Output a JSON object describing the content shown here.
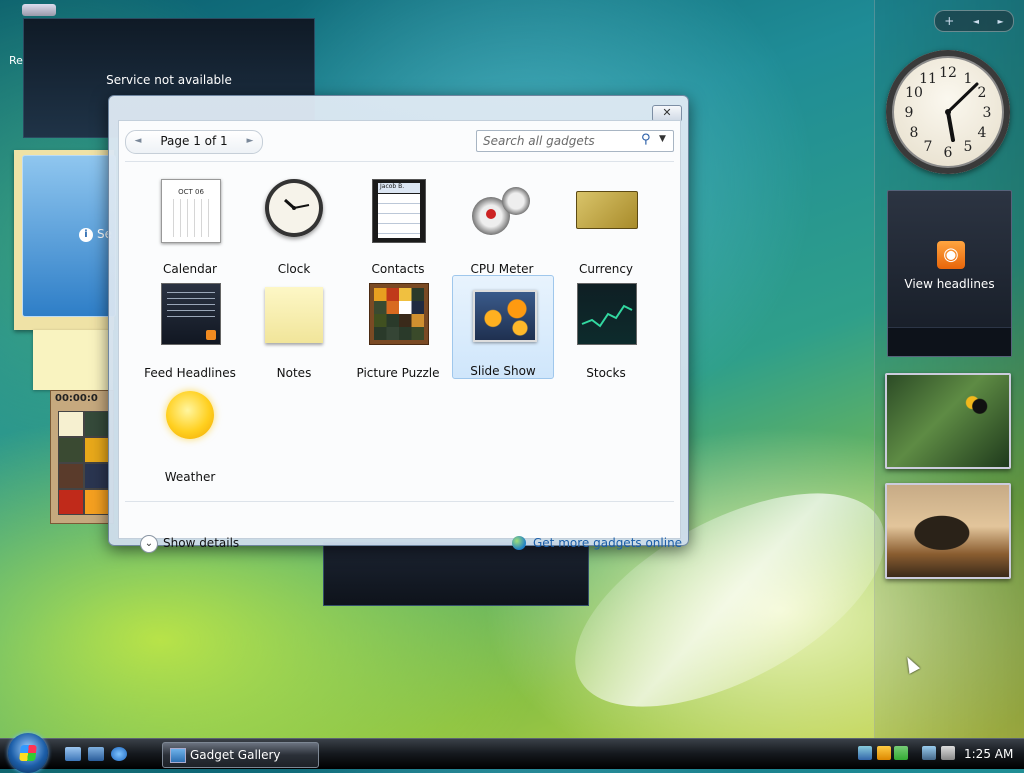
{
  "desktop": {
    "left_fragment_label": "Re",
    "bg_gadget_message": "Service not available",
    "bg_blue_fragment": "Se",
    "bg_puzzle_time": "00:00:0"
  },
  "sidebar": {
    "controls": {
      "add": "+",
      "prev": "◄",
      "next": "►"
    },
    "feed_label": "View headlines",
    "icons": [
      "clock-icon",
      "rss-icon"
    ]
  },
  "gallery": {
    "close_label": "✕",
    "pager": {
      "prev": "◄",
      "text": "Page 1 of 1",
      "next": "►"
    },
    "search": {
      "placeholder": "Search all gadgets"
    },
    "items": [
      {
        "label": "Calendar"
      },
      {
        "label": "Clock"
      },
      {
        "label": "Contacts"
      },
      {
        "label": "CPU Meter"
      },
      {
        "label": "Currency"
      },
      {
        "label": "Feed Headlines"
      },
      {
        "label": "Notes"
      },
      {
        "label": "Picture Puzzle"
      },
      {
        "label": "Slide Show",
        "selected": true
      },
      {
        "label": "Stocks"
      },
      {
        "label": "Weather"
      }
    ],
    "calendar_header": "OCT 06",
    "contacts_header": "Jacob B.",
    "show_details": "Show details",
    "get_more": "Get more gadgets online"
  },
  "taskbar": {
    "task_button": "Gadget Gallery",
    "time": "1:25 AM"
  },
  "colors": {
    "accent": "#1b5ea8",
    "selection": "#cfe6fb"
  }
}
